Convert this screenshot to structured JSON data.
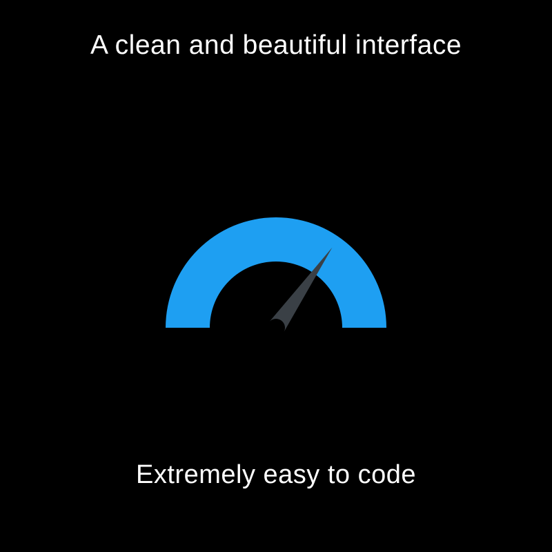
{
  "header": {
    "title": "A clean and beautiful interface"
  },
  "gauge": {
    "arc_color": "#1E9FF2",
    "needle_color": "#3A4046",
    "needle_angle_deg": 125,
    "background": "#000000"
  },
  "footer": {
    "subtitle": "Extremely easy to code"
  }
}
